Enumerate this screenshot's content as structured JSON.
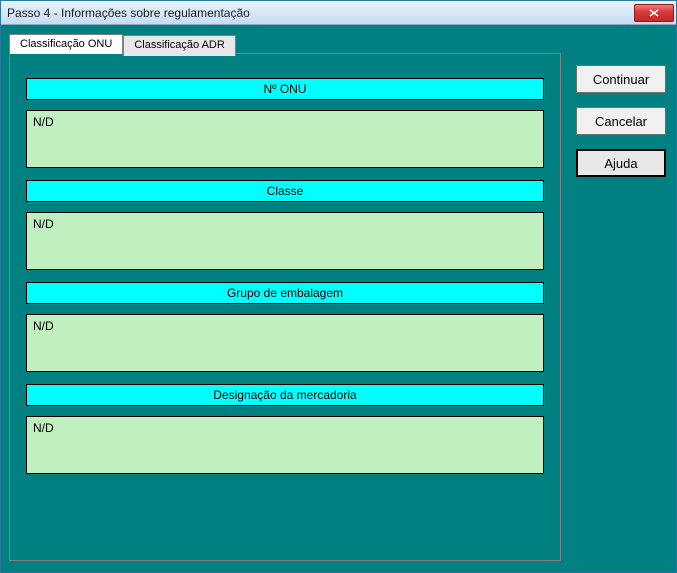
{
  "window": {
    "title": "Passo 4 - Informações sobre regulamentação"
  },
  "tabs": {
    "onu": "Classificação ONU",
    "adr": "Classificação ADR"
  },
  "sections": {
    "onu_number": {
      "header": "Nº ONU",
      "value": "N/D"
    },
    "classe": {
      "header": "Classe",
      "value": "N/D"
    },
    "grupo": {
      "header": "Grupo de embalagem",
      "value": "N/D"
    },
    "designacao": {
      "header": "Designação da mercadoria",
      "value": "N/D"
    }
  },
  "buttons": {
    "continuar": "Continuar",
    "cancelar": "Cancelar",
    "ajuda": "Ajuda"
  }
}
